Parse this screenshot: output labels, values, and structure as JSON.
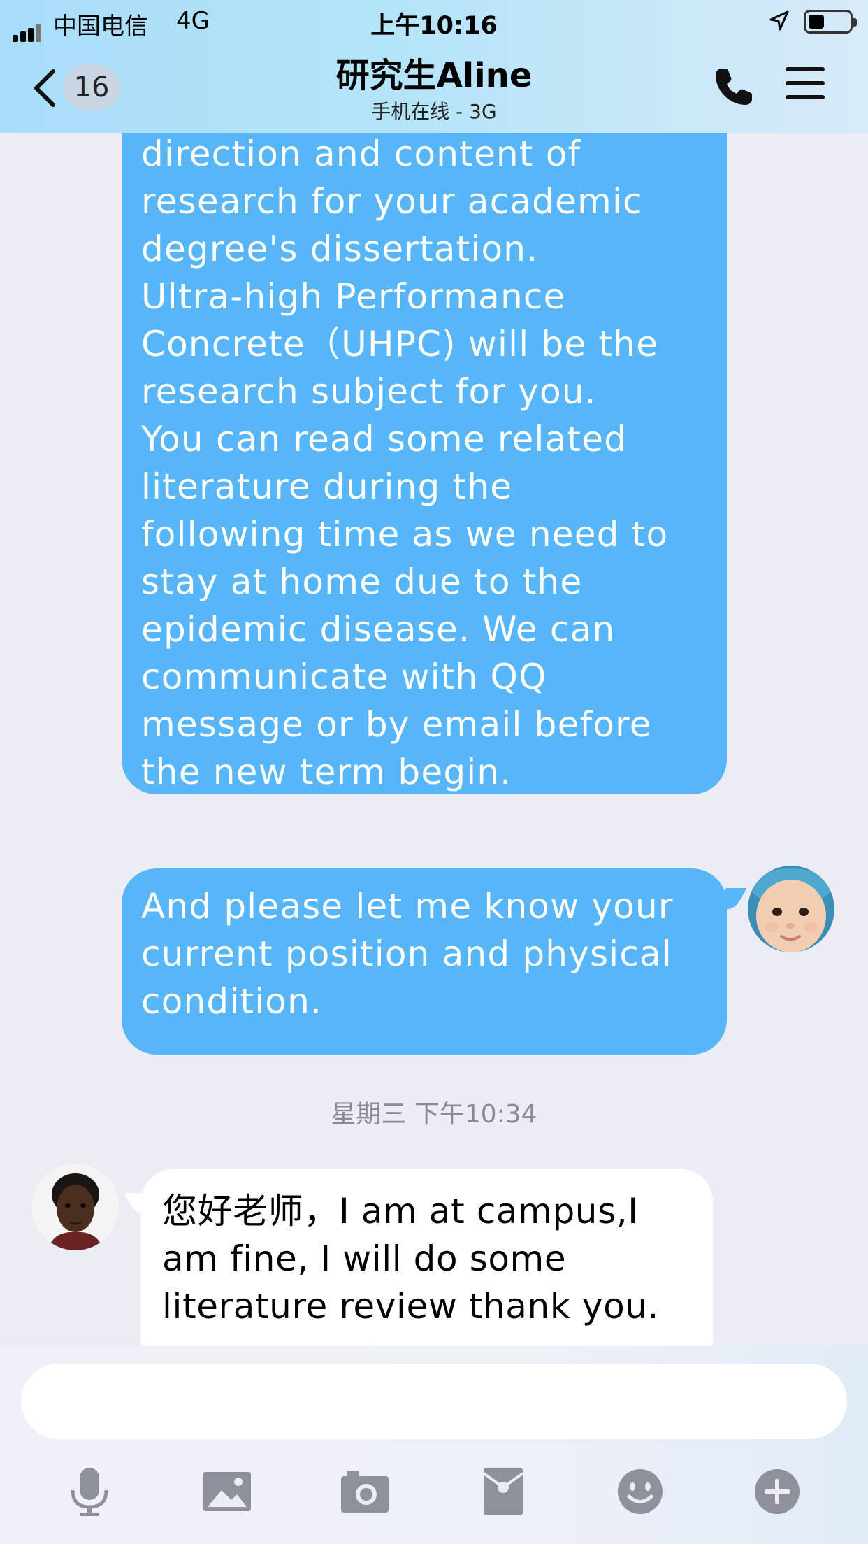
{
  "status_bar": {
    "carrier": "中国电信",
    "network": "4G",
    "time": "上午10:16",
    "battery_level": 0.4
  },
  "header": {
    "back_count": "16",
    "title": "研究生Aline",
    "subtitle": "手机在线 - 3G",
    "icons": [
      "back-chevron-icon",
      "phone-icon",
      "menu-icon"
    ]
  },
  "messages": [
    {
      "sender": "self",
      "text": "direction and content of\nresearch for your academic\ndegree's dissertation.\nUltra-high Performance\nConcrete（UHPC) will be the\nresearch subject for you.\nYou can read some related\nliterature during the\nfollowing time as we need to\nstay at home due to the\nepidemic disease. We can\ncommunicate with QQ\nmessage or by email before\nthe new term begin."
    },
    {
      "sender": "self",
      "text": "And please let me know your\ncurrent position and physical\n condition."
    },
    {
      "sender": "peer",
      "text": "您好老师，I am at campus,I\nam fine, I will do some\nliterature review thank you."
    }
  ],
  "timestamp": "星期三 下午10:34",
  "input": {
    "value": "",
    "placeholder": ""
  },
  "toolbar": [
    "microphone-icon",
    "image-icon",
    "camera-icon",
    "red-packet-icon",
    "emoji-icon",
    "plus-icon"
  ],
  "colors": {
    "outgoing_bubble": "#57B5F9",
    "incoming_bubble": "#FFFFFF",
    "chat_background": "#ECEDF4",
    "toolbar_icon": "#8E909C"
  }
}
